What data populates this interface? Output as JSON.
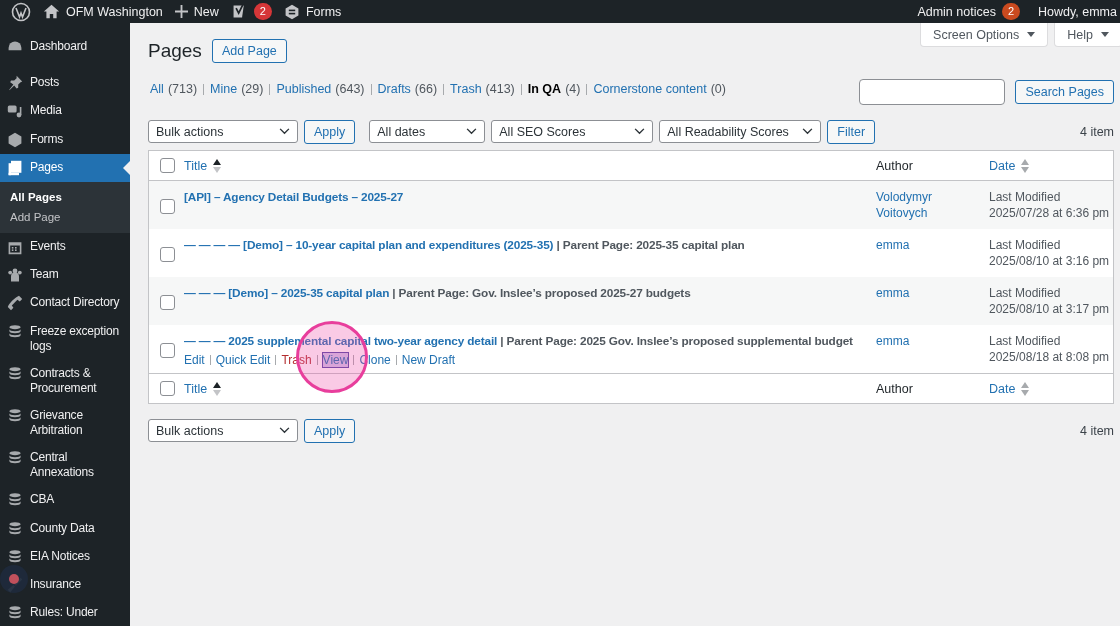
{
  "admin_bar": {
    "site_name": "OFM Washington",
    "new_label": "New",
    "seo_badge": "2",
    "forms_label": "Forms",
    "notices_label": "Admin notices",
    "notices_badge": "2",
    "greeting": "Howdy, emma"
  },
  "sidebar": {
    "items": [
      {
        "label": "Dashboard",
        "selected": false
      },
      {
        "label": "Posts",
        "selected": false
      },
      {
        "label": "Media",
        "selected": false
      },
      {
        "label": "Forms",
        "selected": false
      },
      {
        "label": "Pages",
        "selected": true,
        "children": [
          {
            "label": "All Pages",
            "selected": true
          },
          {
            "label": "Add Page",
            "selected": false
          }
        ]
      },
      {
        "label": "Events",
        "selected": false
      },
      {
        "label": "Team",
        "selected": false
      },
      {
        "label": "Contact Directory",
        "selected": false
      },
      {
        "label": "Freeze exception logs",
        "selected": false
      },
      {
        "label": "Contracts & Procurement",
        "selected": false
      },
      {
        "label": "Grievance Arbitration",
        "selected": false
      },
      {
        "label": "Central Annexations",
        "selected": false
      },
      {
        "label": "CBA",
        "selected": false
      },
      {
        "label": "County Data",
        "selected": false
      },
      {
        "label": "EIA Notices",
        "selected": false
      },
      {
        "label": "Insurance",
        "selected": false
      },
      {
        "label": "Rules: Under",
        "selected": false
      }
    ]
  },
  "screen_tabs": [
    {
      "label": "Screen Options"
    },
    {
      "label": "Help"
    }
  ],
  "heading": "Pages",
  "add_button": "Add Page",
  "views": [
    {
      "label": "All",
      "count": "(713)",
      "selected": false
    },
    {
      "label": "Mine",
      "count": "(29)",
      "selected": false
    },
    {
      "label": "Published",
      "count": "(643)",
      "selected": false
    },
    {
      "label": "Drafts",
      "count": "(66)",
      "selected": false
    },
    {
      "label": "Trash",
      "count": "(413)",
      "selected": false
    },
    {
      "label": "In QA",
      "count": "(4)",
      "selected": true
    },
    {
      "label": "Cornerstone content",
      "count": "(0)",
      "selected": false
    }
  ],
  "search": {
    "button": "Search Pages"
  },
  "filters": {
    "bulk": "Bulk actions",
    "apply": "Apply",
    "dates": "All dates",
    "seo": "All SEO Scores",
    "readability": "All Readability Scores",
    "filter": "Filter",
    "count": "4 item"
  },
  "table": {
    "select_all_checked": false,
    "columns": [
      {
        "label": "Title",
        "sortable": true,
        "sorted_ascending": true
      },
      {
        "label": "Author",
        "sortable": false
      },
      {
        "label": "Date",
        "sortable": true,
        "sorted_ascending": false
      }
    ],
    "footer_select_all_checked": false,
    "footer_columns": [
      {
        "label": "Title",
        "sortable": true,
        "sorted_ascending": true
      },
      {
        "label": "Author",
        "sortable": false
      },
      {
        "label": "Date",
        "sortable": true,
        "sorted_ascending": false
      }
    ],
    "rows": [
      {
        "title": "[API] – Agency Detail Budgets – 2025-27",
        "checked": false,
        "author": "Volodymyr Voitovych",
        "status": "Last Modified",
        "date": "2025/07/28 at 6:36 pm"
      },
      {
        "title": "— — — — [Demo] – 10-year capital plan and expenditures (2025-35)",
        "parent": " | Parent Page: 2025-35 capital plan",
        "checked": false,
        "author": "emma",
        "status": "Last Modified",
        "date": "2025/08/10 at 3:16 pm"
      },
      {
        "title": "— — — [Demo] – 2025-35 capital plan",
        "parent": " | Parent Page: Gov. Inslee’s proposed 2025-27 budgets",
        "checked": false,
        "author": "emma",
        "status": "Last Modified",
        "date": "2025/08/10 at 3:17 pm"
      },
      {
        "title": "— — — 2025 supplemental capital two-year agency detail",
        "parent": " | Parent Page: 2025 Gov. Inslee’s proposed supplemental budget",
        "checked": false,
        "author": "emma",
        "status": "Last Modified",
        "date": "2025/08/18 at 8:08 pm",
        "actions": [
          {
            "label": "Edit",
            "kind": "link",
            "highlighted": false
          },
          {
            "label": "Quick Edit",
            "kind": "link",
            "highlighted": false
          },
          {
            "label": "Trash",
            "kind": "delete",
            "highlighted": false
          },
          {
            "label": "View",
            "kind": "link",
            "highlighted": true
          },
          {
            "label": "Clone",
            "kind": "link",
            "highlighted": false
          },
          {
            "label": "New Draft",
            "kind": "link",
            "highlighted": false
          }
        ]
      }
    ]
  },
  "bottom": {
    "bulk": "Bulk actions",
    "apply": "Apply",
    "count": "4 item"
  }
}
